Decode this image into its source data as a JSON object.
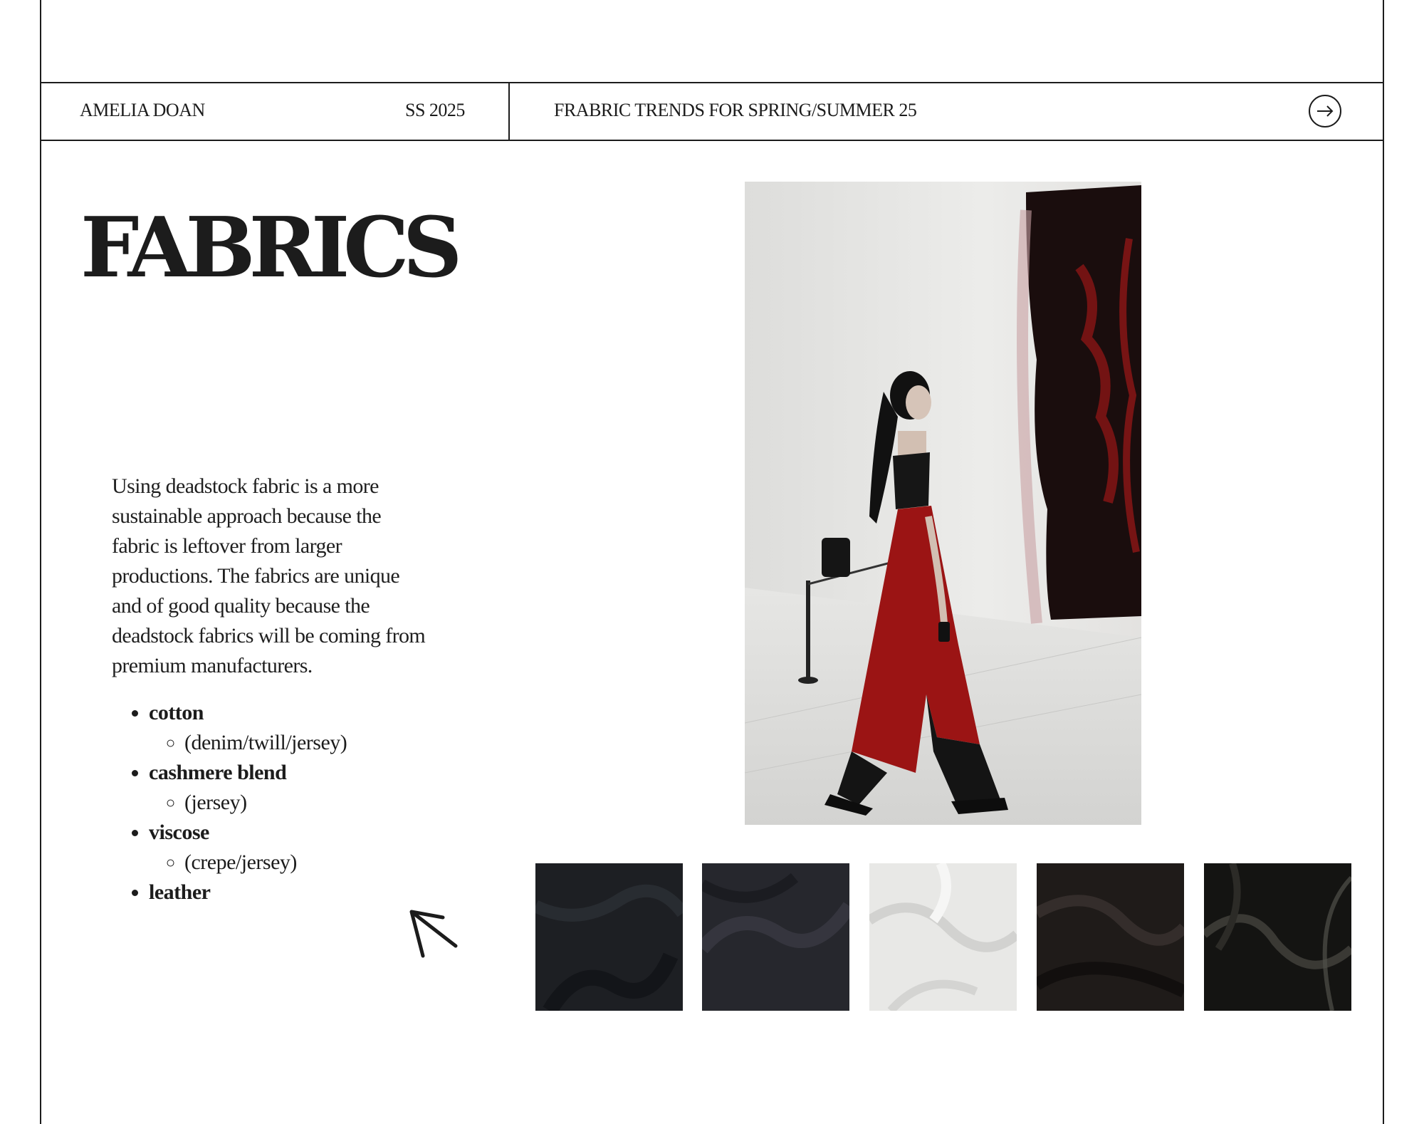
{
  "header": {
    "author": "AMELIA DOAN",
    "season": "SS 2025",
    "topic": "FRABRIC TRENDS FOR SPRING/SUMMER 25",
    "next_icon": "arrow-right-circle-icon"
  },
  "main": {
    "title": "FABRICS",
    "description": "Using deadstock fabric is a more sustainable approach because the fabric is leftover from larger productions. The fabrics are unique and of good quality because the deadstock fabrics will be coming from premium manufacturers.",
    "fabrics": [
      {
        "name": "cotton",
        "types": "(denim/twill/jersey)"
      },
      {
        "name": "cashmere blend",
        "types": "(jersey)"
      },
      {
        "name": "viscose",
        "types": "(crepe/jersey)"
      },
      {
        "name": "leather",
        "types": ""
      }
    ],
    "back_icon": "arrow-up-left-icon"
  },
  "swatches": [
    {
      "name": "black-denim",
      "color": "#1d1f23"
    },
    {
      "name": "charcoal-jersey",
      "color": "#26272d"
    },
    {
      "name": "white-jersey",
      "color": "#e8e8e6"
    },
    {
      "name": "black-crepe",
      "color": "#1f1b19"
    },
    {
      "name": "black-leather",
      "color": "#141412"
    }
  ],
  "colors": {
    "ink": "#1c1c1c",
    "skirt_red": "#9b1414",
    "artwork_red": "#7a1010"
  }
}
